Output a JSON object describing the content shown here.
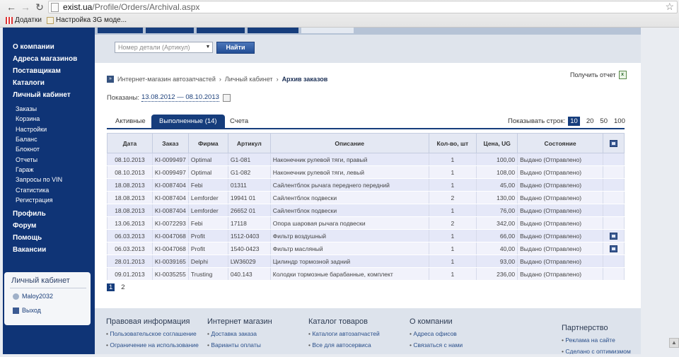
{
  "browser": {
    "url_host": "exist.ua",
    "url_path": "/Profile/Orders/Archival.aspx",
    "bookmarks": [
      "Додатки",
      "Настройка 3G моде..."
    ]
  },
  "sidebar": {
    "main_items": [
      "О компании",
      "Адреса магазинов",
      "Поставщикам",
      "Каталоги",
      "Личный кабинет"
    ],
    "sub_items": [
      "Заказы",
      "Корзина",
      "Настройки",
      "Баланс",
      "Блокнот",
      "Отчеты",
      "Гараж",
      "Запросы по VIN",
      "Статистика",
      "Регистрация"
    ],
    "bottom_items": [
      "Профиль",
      "Форум",
      "Помощь",
      "Вакансии"
    ],
    "cabinet": {
      "title": "Личный кабинет",
      "user": "Maloy2032",
      "logout": "Выход"
    }
  },
  "search": {
    "placeholder": "Номер детали (Артикул)",
    "button": "Найти"
  },
  "breadcrumb": [
    "Интернет-магазин автозапчастей",
    "Личный кабинет",
    "Архив заказов"
  ],
  "report_link": "Получить отчет",
  "shown": {
    "label": "Показаны:",
    "range": "13.08.2012 — 08.10.2013"
  },
  "tabs": [
    "Активные",
    "Выполненные (14)",
    "Счета"
  ],
  "rows_selector": {
    "label": "Показывать строк:",
    "options": [
      "10",
      "20",
      "50",
      "100"
    ],
    "selected": "10"
  },
  "table": {
    "headers": [
      "Дата",
      "Заказ",
      "Фирма",
      "Артикул",
      "Описание",
      "Кол-во, шт",
      "Цена, UG",
      "Состояние"
    ],
    "rows": [
      [
        "08.10.2013",
        "KI-0099497",
        "Optimal",
        "G1-081",
        "Наконечник рулевой тяги, правый",
        "1",
        "100,00",
        "Выдано (Отправлено)"
      ],
      [
        "08.10.2013",
        "KI-0099497",
        "Optimal",
        "G1-082",
        "Наконечник рулевой тяги, левый",
        "1",
        "108,00",
        "Выдано (Отправлено)"
      ],
      [
        "18.08.2013",
        "KI-0087404",
        "Febi",
        "01311",
        "Сайлентблок рычага переднего передний",
        "1",
        "45,00",
        "Выдано (Отправлено)"
      ],
      [
        "18.08.2013",
        "KI-0087404",
        "Lemforder",
        "19941 01",
        "Сайлентблок подвески",
        "2",
        "130,00",
        "Выдано (Отправлено)"
      ],
      [
        "18.08.2013",
        "KI-0087404",
        "Lemforder",
        "26652 01",
        "Сайлентблок подвески",
        "1",
        "76,00",
        "Выдано (Отправлено)"
      ],
      [
        "13.06.2013",
        "KI-0072293",
        "Febi",
        "17118",
        "Опора шаровая рычага подвески",
        "2",
        "342,00",
        "Выдано (Отправлено)"
      ],
      [
        "06.03.2013",
        "KI-0047068",
        "Profit",
        "1512-0403",
        "Фильтр воздушный",
        "1",
        "66,00",
        "Выдано (Отправлено)"
      ],
      [
        "06.03.2013",
        "KI-0047068",
        "Profit",
        "1540-0423",
        "Фильтр масляный",
        "1",
        "40,00",
        "Выдано (Отправлено)"
      ],
      [
        "28.01.2013",
        "KI-0039165",
        "Delphi",
        "LW36029",
        "Цилиндр тормозной задний",
        "1",
        "93,00",
        "Выдано (Отправлено)"
      ],
      [
        "09.01.2013",
        "KI-0035255",
        "Trusting",
        "040.143",
        "Колодки тормозные барабанные, комплект",
        "1",
        "236,00",
        "Выдано (Отправлено)"
      ]
    ],
    "row_icons": [
      false,
      false,
      false,
      false,
      false,
      false,
      true,
      true,
      false,
      false
    ]
  },
  "pager": [
    "1",
    "2"
  ],
  "footer": {
    "columns": [
      {
        "title": "Правовая информация",
        "links": [
          "Пользовательское соглашение",
          "Ограничение на использование"
        ]
      },
      {
        "title": "Интернет магазин",
        "links": [
          "Доставка заказа",
          "Варианты оплаты"
        ]
      },
      {
        "title": "Каталог товаров",
        "links": [
          "Каталоги автозапчастей",
          "Все для автосервиса"
        ]
      },
      {
        "title": "О компании",
        "links": [
          "Адреса офисов",
          "Связаться с нами"
        ]
      },
      {
        "title": "Партнерство",
        "links": [
          "Реклама на сайте",
          "Сделано с оптимизмом"
        ]
      }
    ]
  }
}
